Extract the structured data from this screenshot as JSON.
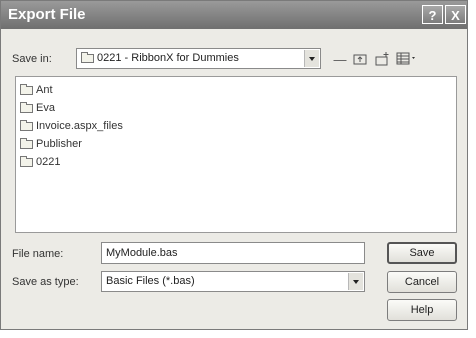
{
  "window": {
    "title": "Export File"
  },
  "titlebar": {
    "help_glyph": "?",
    "close_glyph": "X"
  },
  "save_in": {
    "label": "Save in:",
    "value": "0221 - RibbonX for Dummies"
  },
  "files": [
    {
      "name": "Ant"
    },
    {
      "name": "Eva"
    },
    {
      "name": "Invoice.aspx_files"
    },
    {
      "name": "Publisher"
    },
    {
      "name": "0221"
    }
  ],
  "file_name": {
    "label": "File name:",
    "value": "MyModule.bas"
  },
  "save_as_type": {
    "label": "Save as type:",
    "value": "Basic Files (*.bas)"
  },
  "buttons": {
    "save": "Save",
    "cancel": "Cancel",
    "help": "Help"
  },
  "toolbar_icons": [
    "back-icon",
    "up-folder-icon",
    "new-folder-icon",
    "view-menu-icon"
  ]
}
